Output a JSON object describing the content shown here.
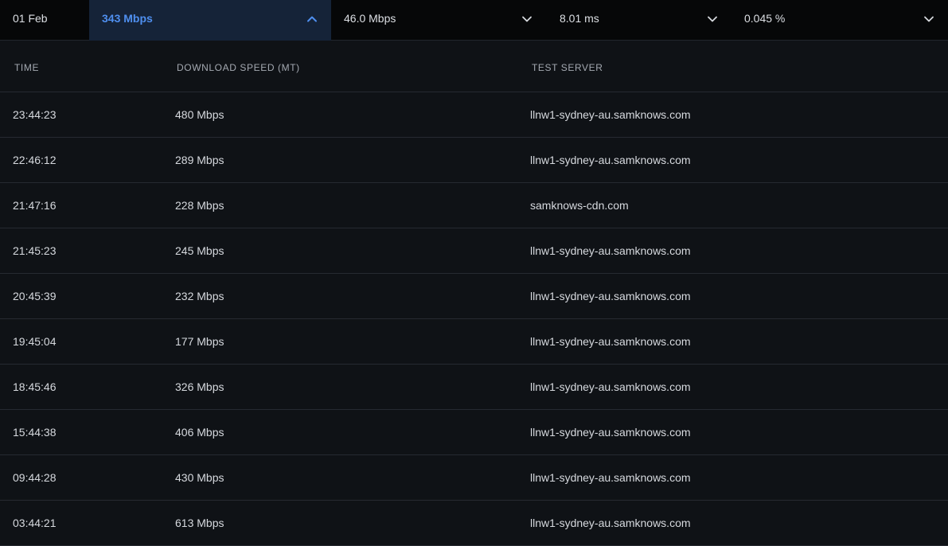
{
  "summary": {
    "date": "01 Feb",
    "download": "343 Mbps",
    "upload": "46.0 Mbps",
    "latency": "8.01 ms",
    "packet_loss": "0.045 %"
  },
  "table": {
    "headers": {
      "time": "TIME",
      "download": "DOWNLOAD SPEED (MT)",
      "server": "TEST SERVER"
    },
    "rows": [
      {
        "time": "23:44:23",
        "speed": "480 Mbps",
        "server": "llnw1-sydney-au.samknows.com"
      },
      {
        "time": "22:46:12",
        "speed": "289 Mbps",
        "server": "llnw1-sydney-au.samknows.com"
      },
      {
        "time": "21:47:16",
        "speed": "228 Mbps",
        "server": "samknows-cdn.com"
      },
      {
        "time": "21:45:23",
        "speed": "245 Mbps",
        "server": "llnw1-sydney-au.samknows.com"
      },
      {
        "time": "20:45:39",
        "speed": "232 Mbps",
        "server": "llnw1-sydney-au.samknows.com"
      },
      {
        "time": "19:45:04",
        "speed": "177 Mbps",
        "server": "llnw1-sydney-au.samknows.com"
      },
      {
        "time": "18:45:46",
        "speed": "326 Mbps",
        "server": "llnw1-sydney-au.samknows.com"
      },
      {
        "time": "15:44:38",
        "speed": "406 Mbps",
        "server": "llnw1-sydney-au.samknows.com"
      },
      {
        "time": "09:44:28",
        "speed": "430 Mbps",
        "server": "llnw1-sydney-au.samknows.com"
      },
      {
        "time": "03:44:21",
        "speed": "613 Mbps",
        "server": "llnw1-sydney-au.samknows.com"
      }
    ]
  },
  "icons": {
    "expanded": "chevron-up-icon",
    "collapsed": "chevron-down-icon"
  },
  "colors": {
    "accent": "#4f8fef",
    "active_bg": "#152338",
    "background": "#0f1216",
    "summary_bg": "#060708"
  }
}
